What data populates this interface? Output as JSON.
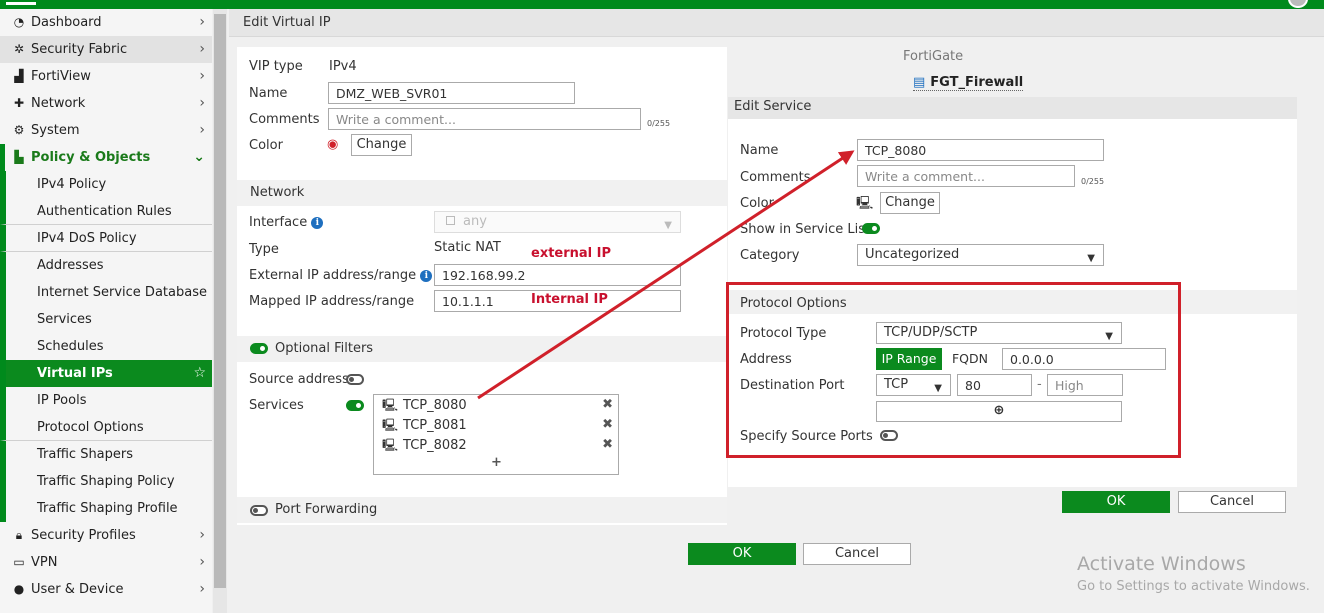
{
  "header": {
    "title": "Edit Virtual IP"
  },
  "sidebar": {
    "items": [
      {
        "label": "Dashboard",
        "icon": "dashboard-icon"
      },
      {
        "label": "Security Fabric",
        "icon": "fabric-icon"
      },
      {
        "label": "FortiView",
        "icon": "chart-icon"
      },
      {
        "label": "Network",
        "icon": "network-icon"
      },
      {
        "label": "System",
        "icon": "gear-icon"
      },
      {
        "label": "Policy & Objects",
        "icon": "policy-icon"
      },
      {
        "label": "IPv4 Policy"
      },
      {
        "label": "Authentication Rules"
      },
      {
        "label": "IPv4 DoS Policy"
      },
      {
        "label": "Addresses"
      },
      {
        "label": "Internet Service Database"
      },
      {
        "label": "Services"
      },
      {
        "label": "Schedules"
      },
      {
        "label": "Virtual IPs"
      },
      {
        "label": "IP Pools"
      },
      {
        "label": "Protocol Options"
      },
      {
        "label": "Traffic Shapers"
      },
      {
        "label": "Traffic Shaping Policy"
      },
      {
        "label": "Traffic Shaping Profile"
      },
      {
        "label": "Security Profiles",
        "icon": "lock-icon"
      },
      {
        "label": "VPN",
        "icon": "laptop-icon"
      },
      {
        "label": "User & Device",
        "icon": "user-icon"
      }
    ]
  },
  "vip": {
    "vip_type_label": "VIP type",
    "vip_type_value": "IPv4",
    "name_label": "Name",
    "name_value": "DMZ_WEB_SVR01",
    "comments_label": "Comments",
    "comments_placeholder": "Write a comment...",
    "comments_counter": "0/255",
    "color_label": "Color",
    "change_label": "Change"
  },
  "network": {
    "section_label": "Network",
    "interface_label": "Interface",
    "interface_value": "any",
    "type_label": "Type",
    "type_value": "Static NAT",
    "external_label": "External IP address/range",
    "external_value": "192.168.99.2",
    "mapped_label": "Mapped IP address/range",
    "mapped_value": "10.1.1.1",
    "note_external": "external IP",
    "note_internal": "Internal IP"
  },
  "filters": {
    "section_label": "Optional Filters",
    "source_label": "Source address",
    "services_label": "Services",
    "services": [
      "TCP_8080",
      "TCP_8081",
      "TCP_8082"
    ],
    "add_symbol": "+"
  },
  "port_forwarding": {
    "label": "Port Forwarding"
  },
  "main_footer": {
    "ok": "OK",
    "cancel": "Cancel"
  },
  "fortigate": {
    "label": "FortiGate",
    "device": "FGT_Firewall"
  },
  "edit_service": {
    "title": "Edit Service",
    "name_label": "Name",
    "name_value": "TCP_8080",
    "comments_label": "Comments",
    "comments_placeholder": "Write a comment...",
    "comments_counter": "0/255",
    "color_label": "Color",
    "change_label": "Change",
    "show_label": "Show in Service List",
    "category_label": "Category",
    "category_value": "Uncategorized",
    "protocol_section": "Protocol Options",
    "protocol_type_label": "Protocol Type",
    "protocol_type_value": "TCP/UDP/SCTP",
    "address_label": "Address",
    "ip_range_label": "IP Range",
    "fqdn_label": "FQDN",
    "address_value": "0.0.0.0",
    "dest_port_label": "Destination Port",
    "dest_proto_value": "TCP",
    "port_low": "80",
    "port_dash": "-",
    "port_high_placeholder": "High",
    "specify_src_label": "Specify Source Ports",
    "ok": "OK",
    "cancel": "Cancel"
  },
  "watermark": {
    "line1": "Activate Windows",
    "line2": "Go to Settings to activate Windows."
  },
  "colors": {
    "accent": "#0b8a1e",
    "highlight_box": "#d0202a",
    "note_text": "#c8102e"
  }
}
